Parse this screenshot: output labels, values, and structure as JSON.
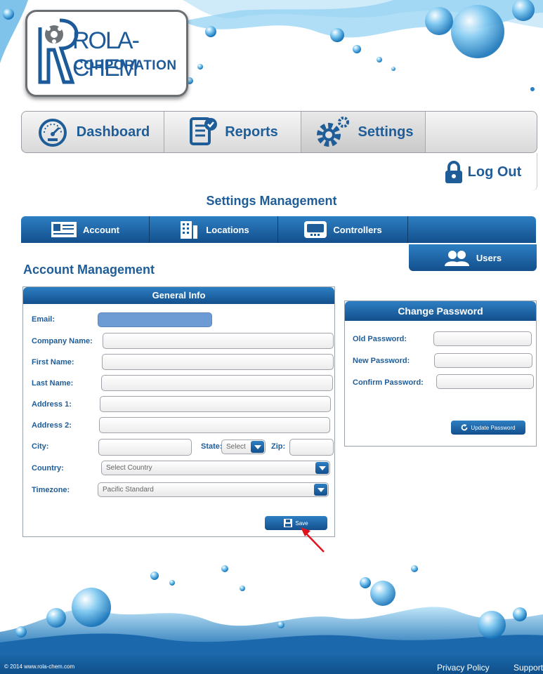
{
  "brand": {
    "line1": "ROLA-CHEM",
    "line2": "CORPORATION"
  },
  "main_nav": [
    {
      "label": "Dashboard",
      "icon": "dashboard-gauge-icon"
    },
    {
      "label": "Reports",
      "icon": "reports-clipboard-icon"
    },
    {
      "label": "Settings",
      "icon": "settings-gear-icon",
      "active": true
    }
  ],
  "logout_label": "Log Out",
  "settings_title": "Settings Management",
  "sub_nav": [
    {
      "label": "Account",
      "icon": "id-card-icon"
    },
    {
      "label": "Locations",
      "icon": "building-icon"
    },
    {
      "label": "Controllers",
      "icon": "controller-display-icon"
    }
  ],
  "users_label": "Users",
  "account_title": "Account Management",
  "general_info": {
    "title": "General Info",
    "labels": {
      "email": "Email:",
      "company": "Company Name:",
      "first": "First Name:",
      "last": "Last Name:",
      "address1": "Address 1:",
      "address2": "Address 2:",
      "city": "City:",
      "state": "State:",
      "zip": "Zip:",
      "country": "Country:",
      "timezone": "Timezone:"
    },
    "state_value": "Select",
    "country_value": "Select Country",
    "timezone_value": "Pacific Standard",
    "save_label": "Save"
  },
  "change_password": {
    "title": "Change Password",
    "old_label": "Old Password:",
    "new_label": "New Password:",
    "confirm_label": "Confirm Password:",
    "update_label": "Update Password"
  },
  "footer": {
    "copyright": "© 2014 www.rola-chem.com",
    "privacy": "Privacy Policy",
    "support": "Support"
  },
  "colors": {
    "accent": "#1f5d99",
    "nav_blue": "#134f8c",
    "annotation_red": "#e0141e"
  }
}
